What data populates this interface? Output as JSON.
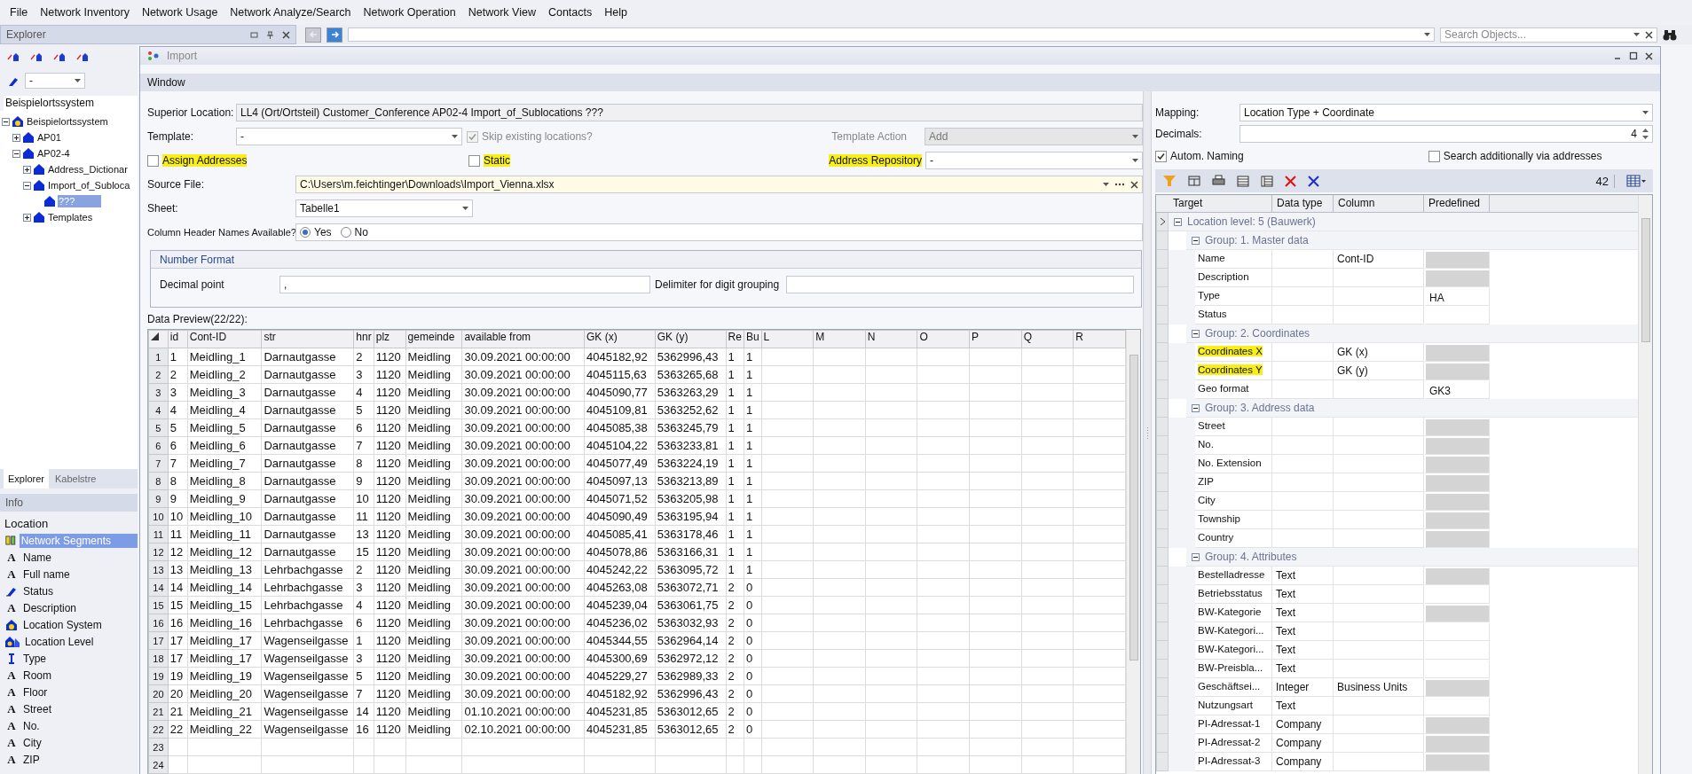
{
  "menu": [
    "File",
    "Network Inventory",
    "Network Usage",
    "Network Analyze/Search",
    "Network Operation",
    "Network View",
    "Contacts",
    "Help"
  ],
  "nav": {
    "search_placeholder": "Search Objects..."
  },
  "explorer": {
    "title": "Explorer",
    "level_select": "-",
    "root_field": "Beispielortssystem",
    "tree": [
      {
        "label": "Beispielortssystem",
        "kind": "system",
        "expanded": true,
        "selected": false,
        "children": [
          {
            "label": "AP01",
            "kind": "location",
            "expanded": false,
            "selected": false
          },
          {
            "label": "AP02-4",
            "kind": "location",
            "expanded": true,
            "selected": false,
            "children": [
              {
                "label": "Address_Dictionar",
                "kind": "location",
                "expanded": false,
                "selected": false
              },
              {
                "label": "Import_of_Subloca",
                "kind": "location",
                "expanded": true,
                "selected": false,
                "children": [
                  {
                    "label": "???",
                    "kind": "location",
                    "selected": true
                  }
                ]
              },
              {
                "label": "Templates",
                "kind": "location",
                "expanded": false,
                "selected": false
              }
            ]
          }
        ]
      }
    ],
    "tabs": [
      {
        "label": "Explorer",
        "selected": true
      },
      {
        "label": "Kabelstre",
        "selected": false
      }
    ]
  },
  "info": {
    "title": "Info",
    "heading": "Location",
    "items": [
      {
        "kind": "segments",
        "label": "Network Segments",
        "selected": true
      },
      {
        "kind": "text",
        "glyph": "A",
        "label": "Name",
        "selected": false
      },
      {
        "kind": "text",
        "glyph": "A",
        "label": "Full name",
        "selected": false
      },
      {
        "kind": "status",
        "label": "Status",
        "selected": false
      },
      {
        "kind": "text",
        "glyph": "A",
        "label": "Description",
        "selected": false
      },
      {
        "kind": "system",
        "label": "Location System",
        "selected": false
      },
      {
        "kind": "level",
        "label": "Location Level",
        "selected": false
      },
      {
        "kind": "type",
        "label": "Type",
        "selected": false
      },
      {
        "kind": "text",
        "glyph": "A",
        "label": "Room",
        "selected": false
      },
      {
        "kind": "text",
        "glyph": "A",
        "label": "Floor",
        "selected": false
      },
      {
        "kind": "text",
        "glyph": "A",
        "label": "Street",
        "selected": false
      },
      {
        "kind": "text",
        "glyph": "A",
        "label": "No.",
        "selected": false
      },
      {
        "kind": "text",
        "glyph": "A",
        "label": "City",
        "selected": false
      },
      {
        "kind": "text",
        "glyph": "A",
        "label": "ZIP",
        "selected": false
      }
    ]
  },
  "import_window": {
    "title": "Import",
    "menu": [
      "Window"
    ],
    "form": {
      "superior_location": {
        "label": "Superior Location:",
        "value": "LL4 (Ort/Ortsteil) Customer_Conference AP02-4 Import_of_Sublocations ???"
      },
      "template": {
        "label": "Template:",
        "value": "-"
      },
      "skip_existing": {
        "label": "Skip existing locations?",
        "checked": true,
        "disabled": true
      },
      "template_action": {
        "label": "Template Action",
        "value": "Add",
        "disabled": true
      },
      "assign_addresses": {
        "label": "Assign Addresses",
        "checked": false,
        "highlighted": true
      },
      "static": {
        "label": "Static",
        "checked": false,
        "highlighted": true
      },
      "address_repository": {
        "label": "Address Repository",
        "value": "-",
        "highlighted": true
      },
      "source_file": {
        "label": "Source File:",
        "value": "C:\\Users\\m.feichtinger\\Downloads\\Import_Vienna.xlsx"
      },
      "sheet": {
        "label": "Sheet:",
        "value": "Tabelle1"
      },
      "column_headers": {
        "label": "Column Header Names Available?",
        "options": [
          {
            "label": "Yes",
            "selected": true
          },
          {
            "label": "No",
            "selected": false
          }
        ]
      },
      "number_format": {
        "title": "Number Format",
        "decimal_point": {
          "label": "Decimal point",
          "value": ","
        },
        "delimiter": {
          "label": "Delimiter for digit grouping"
        }
      }
    },
    "preview": {
      "title": "Data Preview(22/22):",
      "columns": [
        "id",
        "Cont-ID",
        "str",
        "hnr",
        "plz",
        "gemeinde",
        "available from",
        "GK (x)",
        "GK (y)",
        "Re",
        "Bu",
        "L",
        "M",
        "N",
        "O",
        "P",
        "Q",
        "R"
      ],
      "row_headers": [
        "1",
        "2",
        "3",
        "4",
        "5",
        "6",
        "7",
        "8",
        "9",
        "10",
        "11",
        "12",
        "13",
        "14",
        "15",
        "16",
        "17",
        "18",
        "19",
        "20",
        "21",
        "22",
        "23",
        "24"
      ],
      "rows": [
        [
          "1",
          "Meidling_1",
          "Darnautgasse",
          "2",
          "1120",
          "Meidling",
          "30.09.2021 00:00:00",
          "4045182,92",
          "5362996,43",
          "1",
          "1"
        ],
        [
          "2",
          "Meidling_2",
          "Darnautgasse",
          "3",
          "1120",
          "Meidling",
          "30.09.2021 00:00:00",
          "4045115,63",
          "5363265,68",
          "1",
          "1"
        ],
        [
          "3",
          "Meidling_3",
          "Darnautgasse",
          "4",
          "1120",
          "Meidling",
          "30.09.2021 00:00:00",
          "4045090,77",
          "5363263,29",
          "1",
          "1"
        ],
        [
          "4",
          "Meidling_4",
          "Darnautgasse",
          "5",
          "1120",
          "Meidling",
          "30.09.2021 00:00:00",
          "4045109,81",
          "5363252,62",
          "1",
          "1"
        ],
        [
          "5",
          "Meidling_5",
          "Darnautgasse",
          "6",
          "1120",
          "Meidling",
          "30.09.2021 00:00:00",
          "4045085,38",
          "5363245,79",
          "1",
          "1"
        ],
        [
          "6",
          "Meidling_6",
          "Darnautgasse",
          "7",
          "1120",
          "Meidling",
          "30.09.2021 00:00:00",
          "4045104,22",
          "5363233,81",
          "1",
          "1"
        ],
        [
          "7",
          "Meidling_7",
          "Darnautgasse",
          "8",
          "1120",
          "Meidling",
          "30.09.2021 00:00:00",
          "4045077,49",
          "5363224,19",
          "1",
          "1"
        ],
        [
          "8",
          "Meidling_8",
          "Darnautgasse",
          "9",
          "1120",
          "Meidling",
          "30.09.2021 00:00:00",
          "4045097,13",
          "5363213,89",
          "1",
          "1"
        ],
        [
          "9",
          "Meidling_9",
          "Darnautgasse",
          "10",
          "1120",
          "Meidling",
          "30.09.2021 00:00:00",
          "4045071,52",
          "5363205,98",
          "1",
          "1"
        ],
        [
          "10",
          "Meidling_10",
          "Darnautgasse",
          "11",
          "1120",
          "Meidling",
          "30.09.2021 00:00:00",
          "4045090,49",
          "5363195,94",
          "1",
          "1"
        ],
        [
          "11",
          "Meidling_11",
          "Darnautgasse",
          "13",
          "1120",
          "Meidling",
          "30.09.2021 00:00:00",
          "4045085,41",
          "5363178,46",
          "1",
          "1"
        ],
        [
          "12",
          "Meidling_12",
          "Darnautgasse",
          "15",
          "1120",
          "Meidling",
          "30.09.2021 00:00:00",
          "4045078,86",
          "5363166,31",
          "1",
          "1"
        ],
        [
          "13",
          "Meidling_13",
          "Lehrbachgasse",
          "2",
          "1120",
          "Meidling",
          "30.09.2021 00:00:00",
          "4045242,22",
          "5363095,72",
          "1",
          "1"
        ],
        [
          "14",
          "Meidling_14",
          "Lehrbachgasse",
          "3",
          "1120",
          "Meidling",
          "30.09.2021 00:00:00",
          "4045263,08",
          "5363072,71",
          "2",
          "0"
        ],
        [
          "15",
          "Meidling_15",
          "Lehrbachgasse",
          "4",
          "1120",
          "Meidling",
          "30.09.2021 00:00:00",
          "4045239,04",
          "5363061,75",
          "2",
          "0"
        ],
        [
          "16",
          "Meidling_16",
          "Lehrbachgasse",
          "6",
          "1120",
          "Meidling",
          "30.09.2021 00:00:00",
          "4045236,02",
          "5363032,93",
          "2",
          "0"
        ],
        [
          "17",
          "Meidling_17",
          "Wagenseilgasse",
          "1",
          "1120",
          "Meidling",
          "30.09.2021 00:00:00",
          "4045344,55",
          "5362964,14",
          "2",
          "0"
        ],
        [
          "17",
          "Meidling_17",
          "Wagenseilgasse",
          "3",
          "1120",
          "Meidling",
          "30.09.2021 00:00:00",
          "4045300,69",
          "5362972,12",
          "2",
          "0"
        ],
        [
          "19",
          "Meidling_19",
          "Wagenseilgasse",
          "5",
          "1120",
          "Meidling",
          "30.09.2021 00:00:00",
          "4045229,27",
          "5362989,33",
          "2",
          "0"
        ],
        [
          "20",
          "Meidling_20",
          "Wagenseilgasse",
          "7",
          "1120",
          "Meidling",
          "30.09.2021 00:00:00",
          "4045182,92",
          "5362996,43",
          "2",
          "0"
        ],
        [
          "21",
          "Meidling_21",
          "Wagenseilgasse",
          "14",
          "1120",
          "Meidling",
          "01.10.2021 00:00:00",
          "4045231,85",
          "5363012,65",
          "2",
          "0"
        ],
        [
          "22",
          "Meidling_22",
          "Wagenseilgasse",
          "16",
          "1120",
          "Meidling",
          "02.10.2021 00:00:00",
          "4045231,85",
          "5363012,65",
          "2",
          "0"
        ]
      ]
    },
    "mapping": {
      "mapping": {
        "label": "Mapping:",
        "value": "Location Type + Coordinate"
      },
      "decimals": {
        "label": "Decimals:",
        "value": "4"
      },
      "autom_naming": {
        "label": "Autom. Naming",
        "checked": true
      },
      "search_addresses": {
        "label": "Search additionally via addresses",
        "checked": false
      },
      "count": "42",
      "columns": [
        "Target",
        "Data type",
        "Column",
        "Predefined"
      ],
      "level": {
        "label": "Location level: 5 (Bauwerk)",
        "expanded": true
      },
      "groups": [
        {
          "label": "Group: 1. Master data",
          "expanded": true,
          "rows": [
            {
              "target": "Name",
              "column": "Cont-ID",
              "locked": true,
              "highlighted": false
            },
            {
              "target": "Description",
              "locked": true,
              "highlighted": false
            },
            {
              "target": "Type",
              "predefined": "HA",
              "locked": false,
              "highlighted": false
            },
            {
              "target": "Status",
              "locked": false,
              "highlighted": false
            }
          ]
        },
        {
          "label": "Group: 2. Coordinates",
          "expanded": true,
          "rows": [
            {
              "target": "Coordinates X",
              "column": "GK (x)",
              "locked": true,
              "highlighted": true
            },
            {
              "target": "Coordinates Y",
              "column": "GK (y)",
              "locked": true,
              "highlighted": true
            },
            {
              "target": "Geo format",
              "predefined": "GK3",
              "locked": false,
              "highlighted": false
            }
          ]
        },
        {
          "label": "Group: 3. Address data",
          "expanded": true,
          "rows": [
            {
              "target": "Street",
              "locked": true,
              "highlighted": false
            },
            {
              "target": "No.",
              "locked": true,
              "highlighted": false
            },
            {
              "target": "No. Extension",
              "locked": true,
              "highlighted": false
            },
            {
              "target": "ZIP",
              "locked": true,
              "highlighted": false
            },
            {
              "target": "City",
              "locked": true,
              "highlighted": false
            },
            {
              "target": "Township",
              "locked": true,
              "highlighted": false
            },
            {
              "target": "Country",
              "locked": true,
              "highlighted": false
            }
          ]
        },
        {
          "label": "Group: 4. Attributes",
          "expanded": true,
          "rows": [
            {
              "target": "Bestelladresse",
              "data_type": "Text",
              "locked": true,
              "highlighted": false
            },
            {
              "target": "Betriebsstatus",
              "data_type": "Text",
              "locked": false,
              "highlighted": false
            },
            {
              "target": "BW-Kategorie",
              "data_type": "Text",
              "locked": true,
              "highlighted": false
            },
            {
              "target": "BW-Kategori...",
              "data_type": "Text",
              "locked": false,
              "highlighted": false
            },
            {
              "target": "BW-Kategori...",
              "data_type": "Text",
              "locked": false,
              "highlighted": false
            },
            {
              "target": "BW-Preisbla...",
              "data_type": "Text",
              "locked": false,
              "highlighted": false
            },
            {
              "target": "Geschäftsei...",
              "data_type": "Integer",
              "column": "Business Units",
              "locked": true,
              "highlighted": false
            },
            {
              "target": "Nutzungsart",
              "data_type": "Text",
              "locked": false,
              "highlighted": false
            },
            {
              "target": "PI-Adressat-1",
              "data_type": "Company",
              "locked": true,
              "highlighted": false
            },
            {
              "target": "PI-Adressat-2",
              "data_type": "Company",
              "locked": true,
              "highlighted": false
            },
            {
              "target": "PI-Adressat-3",
              "data_type": "Company",
              "locked": true,
              "highlighted": false
            }
          ]
        }
      ]
    }
  }
}
